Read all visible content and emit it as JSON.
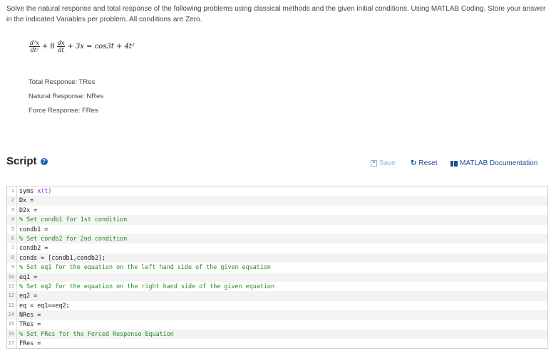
{
  "problem": {
    "text": "Solve the natural response and total response of the following problems using classical methods and the given initial conditions. Using MATLAB Coding. Store your answer in the indicated Variables per problem. All conditions are Zero."
  },
  "equation": {
    "term1_num": "d²x",
    "term1_den": "dt²",
    "plus1": "+ 8",
    "term2_num": "dx",
    "term2_den": "dt",
    "rest": "+ 3x = cos3t + 4t²"
  },
  "variables": {
    "total": "Total Response: TRes",
    "natural": "Natural Response: NRes",
    "force": "Force Response: FRes"
  },
  "script": {
    "title": "Script",
    "help_icon": "?",
    "save_label": "Save",
    "reset_label": "Reset",
    "doc_label": "MATLAB Documentation"
  },
  "code_lines": [
    {
      "n": "1",
      "text": "syms ",
      "extra": "x(t)",
      "comment": false
    },
    {
      "n": "2",
      "text": "Dx =",
      "comment": false
    },
    {
      "n": "3",
      "text": "D2x =",
      "comment": false
    },
    {
      "n": "4",
      "text": "% Set condb1 for 1st condition",
      "comment": true
    },
    {
      "n": "5",
      "text": "condb1 =",
      "comment": false
    },
    {
      "n": "6",
      "text": "% Set condb2 for 2nd condition",
      "comment": true
    },
    {
      "n": "7",
      "text": "condb2 =",
      "comment": false
    },
    {
      "n": "8",
      "text": "conds = [condb1,condb2];",
      "comment": false
    },
    {
      "n": "9",
      "text": "% Set eq1 for the equation on the left hand side of the given equation",
      "comment": true
    },
    {
      "n": "10",
      "text": "eq1 =",
      "comment": false
    },
    {
      "n": "11",
      "text": "% Set eq2 for the equation on the right hand side of the given equation",
      "comment": true
    },
    {
      "n": "12",
      "text": "eq2 =",
      "comment": false
    },
    {
      "n": "13",
      "text": "eq = eq1==eq2;",
      "comment": false
    },
    {
      "n": "14",
      "text": "NRes =",
      "comment": false
    },
    {
      "n": "15",
      "text": "TRes =",
      "comment": false
    },
    {
      "n": "16",
      "text": "% Set FRes for the Forced Response Equation",
      "comment": true
    },
    {
      "n": "17",
      "text": "FRes =",
      "comment": false
    }
  ]
}
